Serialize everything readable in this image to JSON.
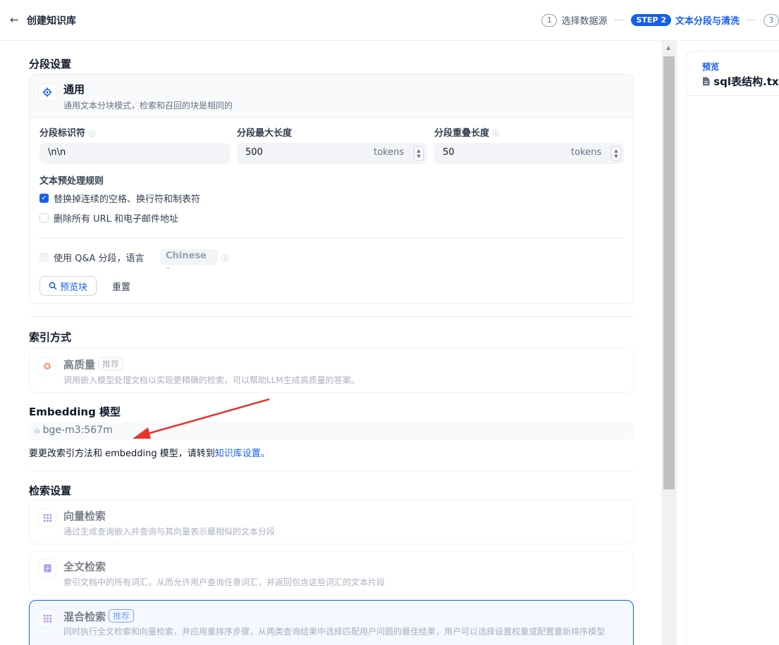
{
  "header": {
    "back_icon": "←",
    "title": "创建知识库",
    "steps": [
      {
        "num": "1",
        "label": "选择数据源"
      },
      {
        "num": "STEP 2",
        "label": "文本分段与清洗"
      },
      {
        "num": "3"
      }
    ]
  },
  "segment": {
    "section_title": "分段设置",
    "card_name": "通用",
    "card_desc": "通用文本分块模式，检索和召回的块是相同的",
    "fields": {
      "separator_label": "分段标识符",
      "separator_value": "\\n\\n",
      "max_len_label": "分段最大长度",
      "max_len_value": "500",
      "overlap_label": "分段重叠长度",
      "overlap_value": "50",
      "unit": "tokens"
    },
    "rules_title": "文本预处理规则",
    "rule1": "替换掉连续的空格、换行符和制表符",
    "rule2": "删除所有 URL 和电子邮件地址",
    "qa_label": "使用 Q&A 分段，语言",
    "qa_language": "Chinese",
    "preview_btn": "预览块",
    "reset_btn": "重置"
  },
  "index": {
    "section_title": "索引方式",
    "name": "高质量",
    "badge": "推荐",
    "desc": "调用嵌入模型处理文档以实现更精确的检索，可以帮助LLM生成高质量的答案。"
  },
  "embedding": {
    "section_title": "Embedding 模型",
    "model": "bge-m3:567m",
    "note_prefix": "要更改索引方法和 embedding 模型，请转到",
    "note_link": "知识库设置",
    "note_suffix": "。"
  },
  "retrieval": {
    "section_title": "检索设置",
    "options": [
      {
        "name": "向量检索",
        "desc": "通过生成查询嵌入并查询与其向量表示最相似的文本分段"
      },
      {
        "name": "全文检索",
        "desc": "索引文档中的所有词汇，从而允许用户查询任意词汇，并返回包含这些词汇的文本片段"
      },
      {
        "name": "混合检索",
        "badge": "推荐",
        "desc": "同时执行全文检索和向量检索，并应用重排序步骤，从两类查询结果中选择匹配用户问题的最佳结果，用户可以选择设置权重或配置重新排序模型"
      }
    ]
  },
  "preview": {
    "label": "预览",
    "file": "sql表结构.tx"
  },
  "colors": {
    "accent": "#155eef",
    "annotation_arrow": "#e8332a"
  }
}
